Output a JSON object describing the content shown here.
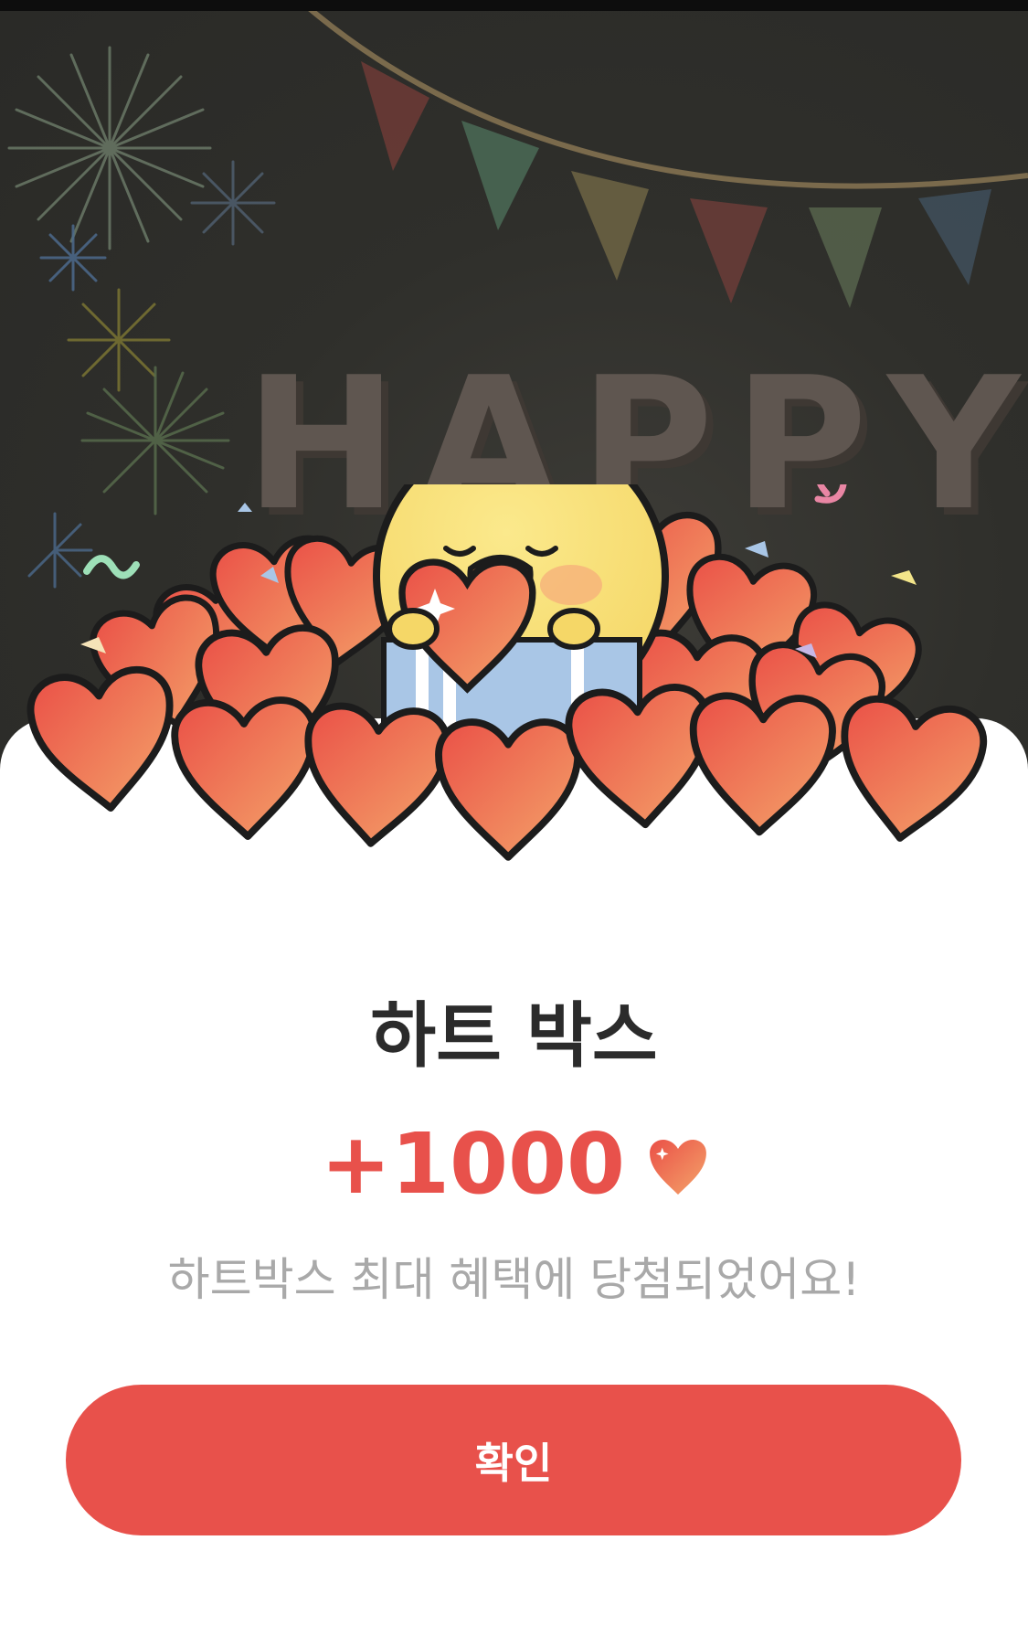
{
  "backdrop": {
    "banner_text": "HAPPY B"
  },
  "reward_sheet": {
    "title": "하트 박스",
    "amount": "+1000",
    "message": "하트박스 최대 혜택에 당첨되었어요!",
    "confirm_label": "확인",
    "heart_icon": "heart-icon"
  },
  "colors": {
    "accent": "#e8514b",
    "title": "#2b2b2b",
    "message": "#a9a9a9",
    "backdrop": "#2f2f2b"
  }
}
